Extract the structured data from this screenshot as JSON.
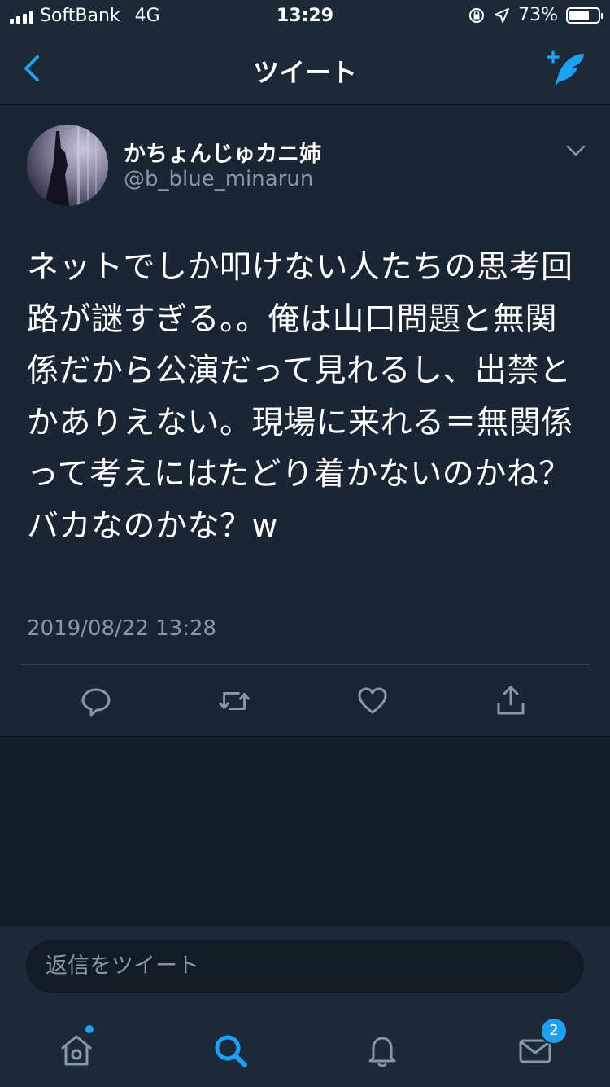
{
  "status_bar": {
    "carrier": "SoftBank",
    "network": "4G",
    "time": "13:29",
    "battery": "73%",
    "battery_level": 0.73
  },
  "nav": {
    "title": "ツイート",
    "back_icon": "chevron-left-icon",
    "compose_icon": "compose-tweet-icon"
  },
  "tweet": {
    "author_name": "かちょんじゅカニ姉",
    "author_handle": "@b_blue_minarun",
    "text": "ネットでしか叩けない人たちの思考回路が謎すぎる。。俺は山口問題と無関係だから公演だって見れるし、出禁とかありえない。現場に来れる＝無関係って考えにはたどり着かないのかね？バカなのかな？w",
    "timestamp": "2019/08/22 13:28",
    "actions": [
      "reply-icon",
      "retweet-icon",
      "like-icon",
      "share-icon"
    ]
  },
  "reply": {
    "placeholder": "返信をツイート"
  },
  "tabbar": {
    "tabs": [
      "home-icon",
      "search-icon",
      "notifications-icon",
      "messages-icon"
    ],
    "messages_badge": "2",
    "active_tab": "search"
  },
  "colors": {
    "accent": "#1da1f2",
    "background": "#151d28",
    "bar": "#1c2938",
    "secondary_text": "#8899a6"
  }
}
